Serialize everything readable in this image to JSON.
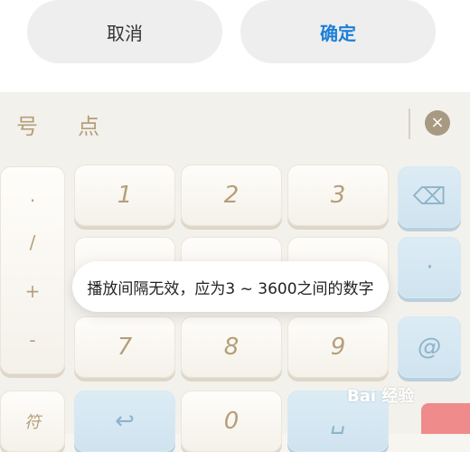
{
  "dialog": {
    "cancel": "取消",
    "confirm": "确定"
  },
  "keyboard": {
    "top_symbols": [
      "号",
      "点"
    ],
    "left_symbols": [
      ".",
      "/",
      "+",
      "-"
    ],
    "rows": [
      [
        "1",
        "2",
        "3"
      ],
      [
        "",
        "",
        ""
      ],
      [
        "7",
        "8",
        "9"
      ],
      [
        "",
        "0",
        ""
      ]
    ],
    "right_keys": [
      "⌫",
      "·",
      "@"
    ],
    "bottom_left_char": "符"
  },
  "toast": {
    "message": "播放间隔无效，应为3 ~ 3600之间的数字"
  },
  "watermark": {
    "text": "Bai 经验"
  }
}
